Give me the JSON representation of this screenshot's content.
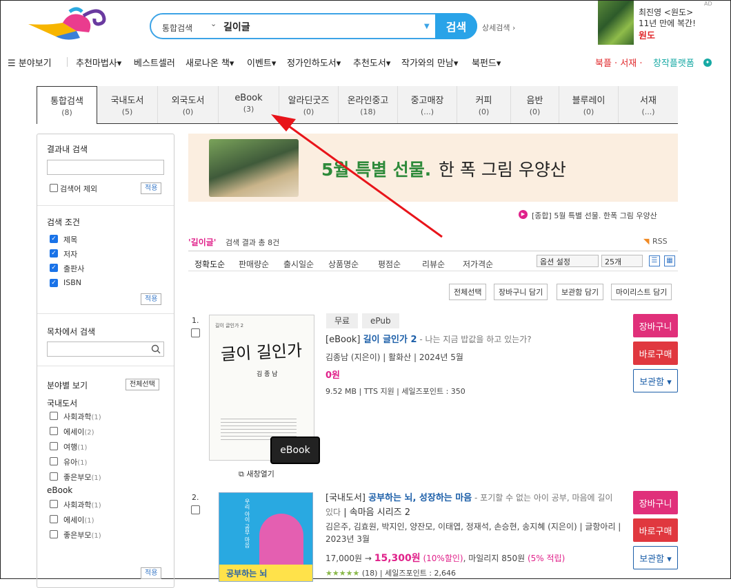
{
  "header": {
    "search_category": "통합검색",
    "search_value": "길이글",
    "search_button": "검색",
    "advanced_search": "상세검색 ›",
    "ad": {
      "tag": "AD",
      "line1": "최진영 <원도>",
      "line2": "11년 만에 복간!",
      "line3": "원도"
    }
  },
  "gnb": {
    "category_menu": "☰ 분야보기",
    "items": [
      "추천마법사▾",
      "베스트셀러",
      "새로나온 책▾",
      "이벤트▾",
      "정가인하도서▾",
      "추천도서▾",
      "작가와의 만남▾",
      "북펀드▾"
    ],
    "right1": "북플 · 서재 ·",
    "right2": "창작플랫폼",
    "right2_icon": "✦"
  },
  "tabs": [
    {
      "label": "통합검색",
      "count": "(8)"
    },
    {
      "label": "국내도서",
      "count": "(5)"
    },
    {
      "label": "외국도서",
      "count": "(0)"
    },
    {
      "label": "eBook",
      "count": "(3)"
    },
    {
      "label": "알라딘굿즈",
      "count": "(0)"
    },
    {
      "label": "온라인중고",
      "count": "(18)"
    },
    {
      "label": "중고매장",
      "count": "(...)"
    },
    {
      "label": "커피",
      "count": "(0)"
    },
    {
      "label": "음반",
      "count": "(0)"
    },
    {
      "label": "블루레이",
      "count": "(0)"
    },
    {
      "label": "서재",
      "count": "(...)"
    }
  ],
  "sidebar": {
    "within_search_title": "결과내 검색",
    "exclude_label": "검색어 제외",
    "apply": "적용",
    "conditions_title": "검색 조건",
    "conditions": [
      "제목",
      "저자",
      "출판사",
      "ISBN"
    ],
    "toc_title": "목차에서 검색",
    "category_title": "분야별 보기",
    "select_all": "전체선택",
    "group1": "국내도서",
    "group1_items": [
      {
        "name": "사회과학",
        "count": "(1)"
      },
      {
        "name": "에세이",
        "count": "(2)"
      },
      {
        "name": "여행",
        "count": "(1)"
      },
      {
        "name": "유아",
        "count": "(1)"
      },
      {
        "name": "좋은부모",
        "count": "(1)"
      }
    ],
    "group2": "eBook",
    "group2_items": [
      {
        "name": "사회과학",
        "count": "(1)"
      },
      {
        "name": "에세이",
        "count": "(1)"
      },
      {
        "name": "좋은부모",
        "count": "(1)"
      }
    ]
  },
  "banner": {
    "title_green": "5월 특별 선물.",
    "title_dark": "한 폭 그림 우양산",
    "caption": "[종합] 5월 특별 선물. 한폭 그림 우양산",
    "caption_icon": "▶"
  },
  "results": {
    "keyword": "'길이글'",
    "summary": "검색 결과 총 8건",
    "rss": "RSS",
    "rss_icon": "◥",
    "sorts": [
      "정확도순",
      "판매량순",
      "출시일순",
      "상품명순",
      "평점순",
      "리뷰순",
      "저가격순"
    ],
    "option_select": "옵션 설정",
    "page_size": "25개",
    "actions": [
      "전체선택",
      "장바구니 담기",
      "보관함 담기",
      "마이리스트 담기"
    ]
  },
  "items": [
    {
      "rank": "1.",
      "tags": [
        "무료",
        "ePub"
      ],
      "category": "[eBook]",
      "title": "길이 글인가 2",
      "subtitle": " - 나는 지금 밥값을 하고 있는가?",
      "meta": "김종남 (지은이) | 활화산 | 2024년 5월",
      "price": "0원",
      "info": "9.52 MB | TTS 지원 | 세일즈포인트 : 350",
      "cover_title": "글이 길인가",
      "cover_author": "김 종 남",
      "cover_top": "길이 글인가 2",
      "badge": "eBook",
      "new_window": "⧉ 새창열기",
      "cart": "장바구니",
      "buy": "바로구매",
      "keep": "보관함 ▾"
    },
    {
      "rank": "2.",
      "category": "[국내도서]",
      "title": "공부하는 뇌, 성장하는 마음",
      "subtitle": " - 포기할 수 없는 아이 공부, 마음에 길이 있다",
      "series": " | 속마음 시리즈 2",
      "meta": "김은주, 김효원, 박지인, 양잔모, 이태엽, 정재석, 손승현, 송지혜 (지은이) | 글항아리 | 2023년 3월",
      "list_price": "17,000원 →",
      "sale_price": "15,300원",
      "discount": "(10%할인)",
      "mileage": ", 마일리지 850원",
      "mileage_pct": "(5% 적립)",
      "stars": "★★★★★",
      "review_info": "(18) | 세일즈포인트 : 2,646",
      "cover_bottom": "공부하는 뇌",
      "cover_side": "우리 아이 공부 마음",
      "cart": "장바구니",
      "buy": "바로구매",
      "keep": "보관함 ▾"
    }
  ],
  "colors": {
    "accent": "#29a3e8",
    "pink": "#e0218a",
    "arrow": "#e8141a"
  }
}
